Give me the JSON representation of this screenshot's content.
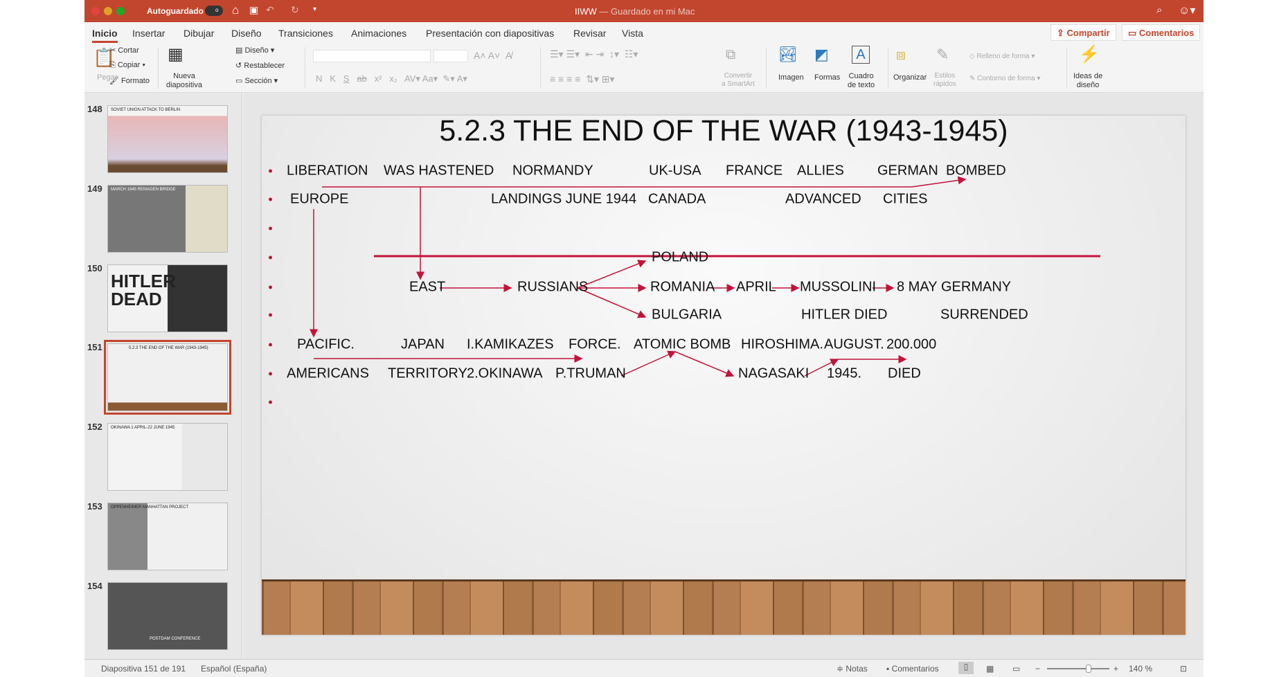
{
  "titlebar": {
    "autosave": "Autoguardado",
    "autosave_state": "o",
    "doc_title": "IIWW",
    "doc_status": "— Guardado en mi Mac"
  },
  "tabs": [
    "Inicio",
    "Insertar",
    "Dibujar",
    "Diseño",
    "Transiciones",
    "Animaciones",
    "Presentación con diapositivas",
    "Revisar",
    "Vista"
  ],
  "header_buttons": {
    "share": "Compartir",
    "comments": "Comentarios"
  },
  "ribbon": {
    "paste": "Pegar",
    "cut": "Cortar",
    "copy": "Copiar",
    "format": "Formato",
    "new_slide_1": "Nueva",
    "new_slide_2": "diapositiva",
    "layout": "Diseño",
    "reset": "Restablecer",
    "section": "Sección",
    "bold": "N",
    "italic": "K",
    "underline": "S",
    "strike": "ab",
    "sup": "x²",
    "sub": "x₂",
    "spacing": "AV",
    "case": "Aa",
    "smartart_1": "Convertir",
    "smartart_2": "a SmartArt",
    "image": "Imagen",
    "shapes": "Formas",
    "textbox_1": "Cuadro",
    "textbox_2": "de texto",
    "arrange": "Organizar",
    "styles_1": "Estilos",
    "styles_2": "rápidos",
    "fill": "Relleno de forma",
    "outline": "Contorno de forma",
    "ideas_1": "Ideas de",
    "ideas_2": "diseño"
  },
  "thumbnails": [
    {
      "num": "148",
      "title": "SOVIET UNION ATTACK TO BERLIN"
    },
    {
      "num": "149",
      "title": "MARCH 1945 REMAGEN BRIDGE"
    },
    {
      "num": "150",
      "title": "HITLER DEAD"
    },
    {
      "num": "151",
      "title": "5.2.3 THE END OF THE WAR (1943-1945)"
    },
    {
      "num": "152",
      "title": "OKINAWA 1 APRIL-22 JUNE 1945"
    },
    {
      "num": "153",
      "title": "OPPENHEIMER MANHATTAN PROJECT"
    },
    {
      "num": "154",
      "title": "POSTDAM CONFERENCE"
    }
  ],
  "slide": {
    "title": "5.2.3 THE END OF THE WAR (1943-1945)",
    "rows": [
      [
        "LIBERATION",
        "WAS HASTENED",
        "NORMANDY",
        "UK-USA",
        "FRANCE",
        "ALLIES",
        "GERMAN",
        "BOMBED"
      ],
      [
        "EUROPE",
        "LANDINGS JUNE 1944",
        "CANADA",
        "ADVANCED",
        "CITIES"
      ],
      [
        "POLAND"
      ],
      [
        "EAST",
        "RUSSIANS",
        "ROMANIA",
        "APRIL",
        "MUSSOLINI",
        "8 MAY",
        "GERMANY"
      ],
      [
        "BULGARIA",
        "HITLER DIED",
        "SURRENDED"
      ],
      [
        "PACIFIC.",
        "JAPAN",
        "I.KAMIKAZES",
        "FORCE.",
        "ATOMIC BOMB",
        "HIROSHIMA.",
        "AUGUST.",
        "200.000"
      ],
      [
        "AMERICANS",
        "TERRITORY",
        "2.OKINAWA",
        "P.TRUMAN",
        "NAGASAKI",
        "1945.",
        "DIED"
      ]
    ],
    "accent": "#c2133a"
  },
  "status": {
    "slide": "Diapositiva 151 de 191",
    "lang": "Español (España)",
    "notes": "Notas",
    "comments": "Comentarios",
    "zoom": "140 %"
  }
}
